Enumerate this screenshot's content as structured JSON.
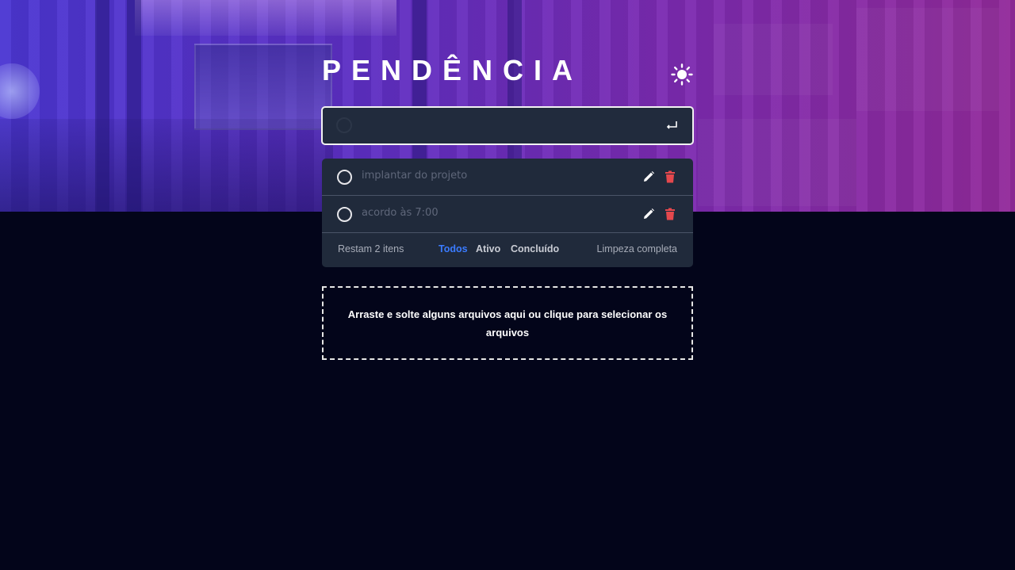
{
  "app": {
    "title": "PENDÊNCIA",
    "theme_icon": "sun-icon"
  },
  "new_todo": {
    "value": "",
    "placeholder": "",
    "submit_icon": "enter-icon"
  },
  "todos": [
    {
      "text": "implantar do projeto",
      "completed": false
    },
    {
      "text": "acordo às 7:00",
      "completed": false
    }
  ],
  "footer": {
    "items_left": "Restam 2 itens",
    "filters": [
      "Todos",
      "Ativo",
      "Concluído"
    ],
    "selected_filter": "Todos",
    "clear_label": "Limpeza completa"
  },
  "dropzone": {
    "text": "Arraste e solte alguns arquivos aqui ou clique para selecionar os arquivos"
  },
  "colors": {
    "background": "#03051a",
    "card": "#202a3b",
    "accent": "#3a7bff",
    "delete": "#e5484d"
  }
}
